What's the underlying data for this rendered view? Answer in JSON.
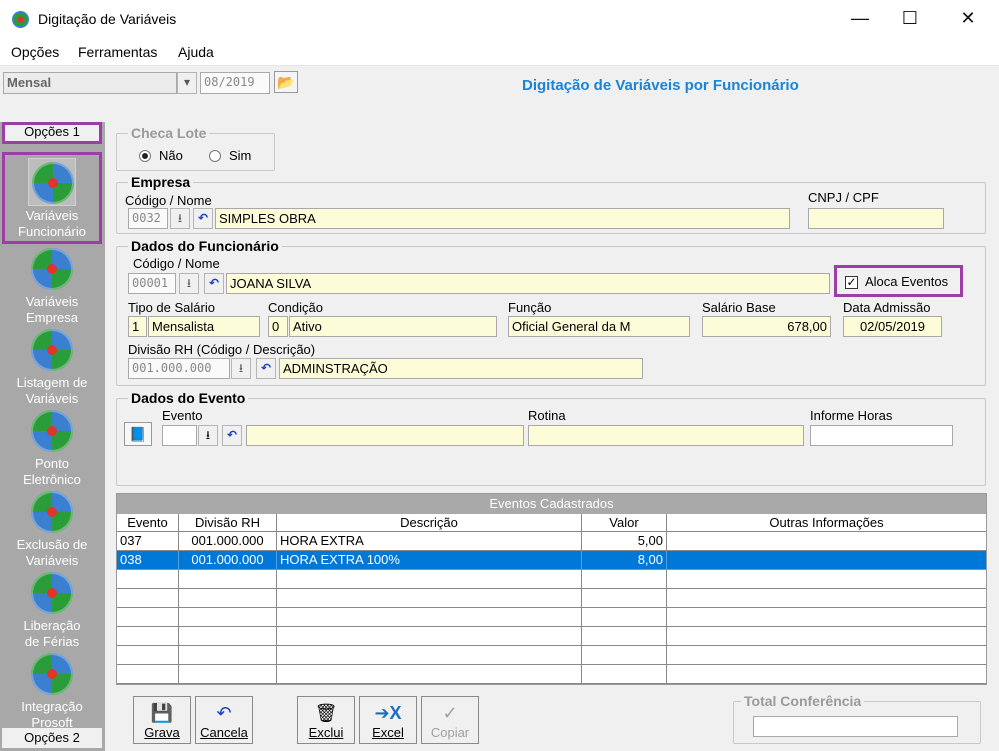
{
  "window": {
    "title": "Digitação de Variáveis",
    "minimize": "—",
    "maximize": "☐",
    "close": "✕"
  },
  "menu": [
    "Opções",
    "Ferramentas",
    "Ajuda"
  ],
  "toolbar": {
    "period_select": "Mensal",
    "period_value": "08/2019",
    "folder_icon": "open-folder-icon"
  },
  "page_heading": "Digitação de Variáveis por Funcionário",
  "sidebar": {
    "top_tab": "Opções 1",
    "bottom_tab": "Opções 2",
    "items": [
      {
        "label": "Variáveis Funcionário",
        "selected": true
      },
      {
        "label": "Variáveis Empresa"
      },
      {
        "label": "Listagem de Variáveis"
      },
      {
        "label": "Ponto Eletrônico"
      },
      {
        "label": "Exclusão de Variáveis"
      },
      {
        "label": "Liberação de Férias"
      },
      {
        "label": "Integração Prosoft"
      }
    ]
  },
  "checa_lote": {
    "title": "Checa Lote",
    "option_no": "Não",
    "option_yes": "Sim",
    "selected": "Não"
  },
  "empresa": {
    "title": "Empresa",
    "code_label": "Código / Nome",
    "code": "0032",
    "name": "SIMPLES OBRA",
    "cnpj_label": "CNPJ / CPF",
    "cnpj": ""
  },
  "funcionario": {
    "title": "Dados do Funcionário",
    "code_label": "Código / Nome",
    "code": "00001",
    "name": "JOANA SILVA",
    "aloca_label": "Aloca Eventos",
    "aloca_checked": true,
    "tipo_label": "Tipo de Salário",
    "tipo_code": "1",
    "tipo_desc": "Mensalista",
    "condicao_label": "Condição",
    "condicao_code": "0",
    "condicao_desc": "Ativo",
    "funcao_label": "Função",
    "funcao": "Oficial General da M",
    "salario_label": "Salário Base",
    "salario": "678,00",
    "admissao_label": "Data Admissão",
    "admissao": "02/05/2019",
    "divisao_label": "Divisão RH (Código / Descrição)",
    "divisao_code": "001.000.000",
    "divisao_desc": "ADMINSTRAÇÃO"
  },
  "evento": {
    "title": "Dados do Evento",
    "evento_label": "Evento",
    "rotina_label": "Rotina",
    "horas_label": "Informe Horas"
  },
  "grid": {
    "caption": "Eventos Cadastrados",
    "columns": [
      "Evento",
      "Divisão RH",
      "Descrição",
      "Valor",
      "Outras Informações"
    ],
    "rows": [
      {
        "evento": "037",
        "divisao": "001.000.000",
        "descricao": "HORA EXTRA",
        "valor": "5,00",
        "outras": ""
      },
      {
        "evento": "038",
        "divisao": "001.000.000",
        "descricao": "HORA EXTRA 100%",
        "valor": "8,00",
        "outras": "",
        "selected": true
      }
    ]
  },
  "buttons": {
    "grava": "Grava",
    "cancela": "Cancela",
    "exclui": "Exclui",
    "excel": "Excel",
    "copiar": "Copiar"
  },
  "total": {
    "title": "Total Conferência",
    "value": ""
  },
  "colors": {
    "accent": "#1a84d6",
    "highlight": "#9b3fa7",
    "selection": "#0078d7",
    "field": "#fdfcd8"
  }
}
